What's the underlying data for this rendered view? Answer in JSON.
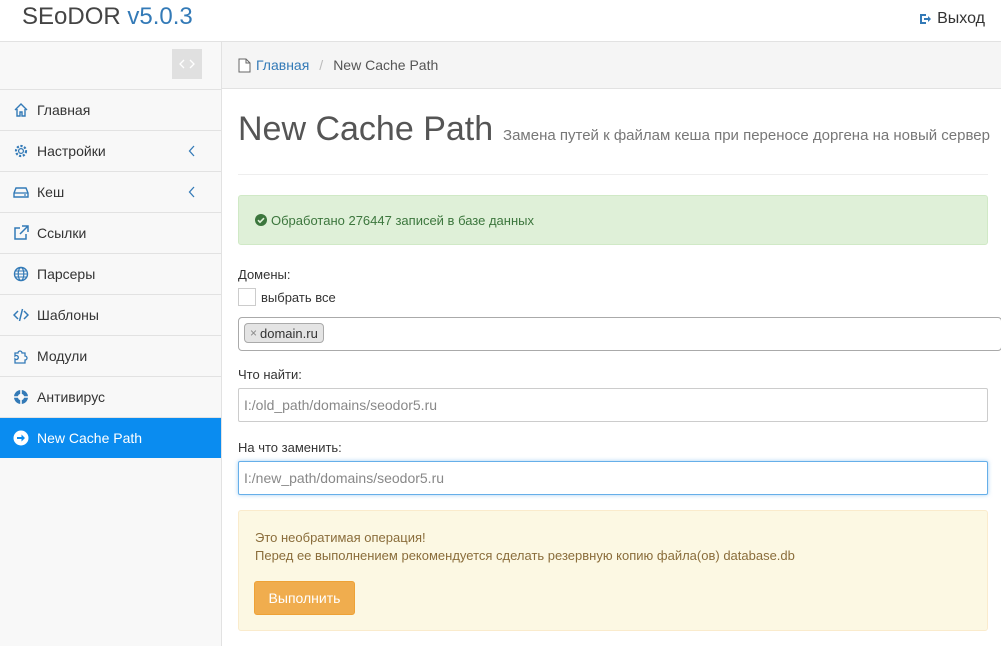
{
  "app": {
    "name": "SEoDOR",
    "version": "v5.0.3"
  },
  "header": {
    "logout_label": "Выход"
  },
  "sidebar": {
    "items": [
      {
        "label": "Главная",
        "icon": "home-icon",
        "has_arrow": false,
        "active": false
      },
      {
        "label": "Настройки",
        "icon": "gear-icon",
        "has_arrow": true,
        "active": false
      },
      {
        "label": "Кеш",
        "icon": "drive-icon",
        "has_arrow": true,
        "active": false
      },
      {
        "label": "Ссылки",
        "icon": "external-link-icon",
        "has_arrow": false,
        "active": false
      },
      {
        "label": "Парсеры",
        "icon": "globe-icon",
        "has_arrow": false,
        "active": false
      },
      {
        "label": "Шаблоны",
        "icon": "code-icon",
        "has_arrow": false,
        "active": false
      },
      {
        "label": "Модули",
        "icon": "puzzle-icon",
        "has_arrow": false,
        "active": false
      },
      {
        "label": "Антивирус",
        "icon": "crosshair-icon",
        "has_arrow": false,
        "active": false
      },
      {
        "label": "New Cache Path",
        "icon": "arrow-circle-right-icon",
        "has_arrow": false,
        "active": true
      }
    ]
  },
  "breadcrumb": {
    "home": "Главная",
    "current": "New Cache Path"
  },
  "page": {
    "title": "New Cache Path",
    "subtitle": "Замена путей к файлам кеша при переносе доргена на новый сервер"
  },
  "success_alert": {
    "text": "Обработано 276447 записей в базе данных"
  },
  "form": {
    "domains_label": "Домены:",
    "select_all_label": "выбрать все",
    "select_all_checked": false,
    "selected_domains": [
      "domain.ru"
    ],
    "find_label": "Что найти:",
    "find_value": "I:/old_path/domains/seodor5.ru",
    "replace_label": "На что заменить:",
    "replace_value": "I:/new_path/domains/seodor5.ru"
  },
  "warning": {
    "line1": "Это необратимая операция!",
    "line2": "Перед ее выполнением рекомендуется сделать резервную копию файла(ов) database.db",
    "button_label": "Выполнить"
  },
  "colors": {
    "accent": "#337ab7",
    "active_nav": "#0a8cf0",
    "success_bg": "#dff0d8",
    "warning_bg": "#fcf8e3",
    "button_warning": "#f0ad4e"
  }
}
